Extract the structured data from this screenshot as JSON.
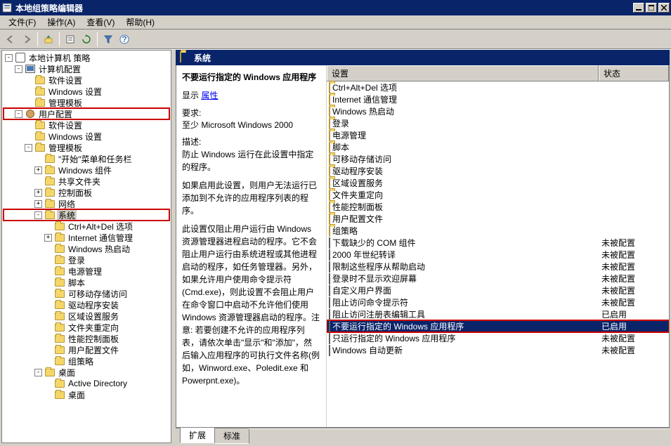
{
  "window": {
    "title": "本地组策略编辑器"
  },
  "menu": {
    "file": "文件(F)",
    "action": "操作(A)",
    "view": "查看(V)",
    "help": "帮助(H)"
  },
  "tree": [
    {
      "depth": 0,
      "exp": "-",
      "icon": "gpo",
      "label": "本地计算机 策略"
    },
    {
      "depth": 1,
      "exp": "-",
      "icon": "computer",
      "label": "计算机配置"
    },
    {
      "depth": 2,
      "exp": " ",
      "icon": "folder",
      "label": "软件设置"
    },
    {
      "depth": 2,
      "exp": " ",
      "icon": "folder",
      "label": "Windows 设置"
    },
    {
      "depth": 2,
      "exp": " ",
      "icon": "folder",
      "label": "管理模板"
    },
    {
      "depth": 1,
      "exp": "-",
      "icon": "user",
      "label": "用户配置",
      "hl": true
    },
    {
      "depth": 2,
      "exp": " ",
      "icon": "folder",
      "label": "软件设置"
    },
    {
      "depth": 2,
      "exp": " ",
      "icon": "folder",
      "label": "Windows 设置"
    },
    {
      "depth": 2,
      "exp": "-",
      "icon": "folder",
      "label": "管理模板"
    },
    {
      "depth": 3,
      "exp": " ",
      "icon": "folder",
      "label": "\"开始\"菜单和任务栏"
    },
    {
      "depth": 3,
      "exp": "+",
      "icon": "folder",
      "label": "Windows 组件"
    },
    {
      "depth": 3,
      "exp": " ",
      "icon": "folder",
      "label": "共享文件夹"
    },
    {
      "depth": 3,
      "exp": "+",
      "icon": "folder",
      "label": "控制面板"
    },
    {
      "depth": 3,
      "exp": "+",
      "icon": "folder",
      "label": "网络"
    },
    {
      "depth": 3,
      "exp": "-",
      "icon": "folder",
      "label": "系统",
      "hl": true,
      "sel": true
    },
    {
      "depth": 4,
      "exp": " ",
      "icon": "folder",
      "label": "Ctrl+Alt+Del 选项"
    },
    {
      "depth": 4,
      "exp": "+",
      "icon": "folder",
      "label": "Internet 通信管理"
    },
    {
      "depth": 4,
      "exp": " ",
      "icon": "folder",
      "label": "Windows 热启动"
    },
    {
      "depth": 4,
      "exp": " ",
      "icon": "folder",
      "label": "登录"
    },
    {
      "depth": 4,
      "exp": " ",
      "icon": "folder",
      "label": "电源管理"
    },
    {
      "depth": 4,
      "exp": " ",
      "icon": "folder",
      "label": "脚本"
    },
    {
      "depth": 4,
      "exp": " ",
      "icon": "folder",
      "label": "可移动存储访问"
    },
    {
      "depth": 4,
      "exp": " ",
      "icon": "folder",
      "label": "驱动程序安装"
    },
    {
      "depth": 4,
      "exp": " ",
      "icon": "folder",
      "label": "区域设置服务"
    },
    {
      "depth": 4,
      "exp": " ",
      "icon": "folder",
      "label": "文件夹重定向"
    },
    {
      "depth": 4,
      "exp": " ",
      "icon": "folder",
      "label": "性能控制面板"
    },
    {
      "depth": 4,
      "exp": " ",
      "icon": "folder",
      "label": "用户配置文件"
    },
    {
      "depth": 4,
      "exp": " ",
      "icon": "folder",
      "label": "组策略"
    },
    {
      "depth": 3,
      "exp": "-",
      "icon": "folder",
      "label": "桌面"
    },
    {
      "depth": 4,
      "exp": " ",
      "icon": "folder",
      "label": "Active Directory"
    },
    {
      "depth": 4,
      "exp": " ",
      "icon": "folder",
      "label": "桌面"
    }
  ],
  "rightHeader": {
    "title": "系统"
  },
  "columns": {
    "name": "设置",
    "state": "状态"
  },
  "desc": {
    "title": "不要运行指定的 Windows 应用程序",
    "show_label": "显示",
    "properties_link": "属性",
    "req_label": "要求:",
    "req_text": "至少 Microsoft Windows 2000",
    "desc_label": "描述:",
    "p1": "防止 Windows 运行在此设置中指定的程序。",
    "p2": "如果启用此设置，则用户无法运行已添加到不允许的应用程序列表的程序。",
    "p3": "此设置仅阻止用户运行由 Windows 资源管理器进程启动的程序。它不会阻止用户运行由系统进程或其他进程启动的程序，如任务管理器。另外，如果允许用户使用命令提示符(Cmd.exe)，则此设置不会阻止用户在命令窗口中启动不允许他们使用 Windows 资源管理器启动的程序。注意: 若要创建不允许的应用程序列表，请依次单击\"显示\"和\"添加\"，然后输入应用程序的可执行文件名称(例如，Winword.exe、Poledit.exe 和 Powerpnt.exe)。"
  },
  "list": [
    {
      "icon": "folder",
      "name": "Ctrl+Alt+Del 选项",
      "state": ""
    },
    {
      "icon": "folder",
      "name": "Internet 通信管理",
      "state": ""
    },
    {
      "icon": "folder",
      "name": "Windows 热启动",
      "state": ""
    },
    {
      "icon": "folder",
      "name": "登录",
      "state": ""
    },
    {
      "icon": "folder",
      "name": "电源管理",
      "state": ""
    },
    {
      "icon": "folder",
      "name": "脚本",
      "state": ""
    },
    {
      "icon": "folder",
      "name": "可移动存储访问",
      "state": ""
    },
    {
      "icon": "folder",
      "name": "驱动程序安装",
      "state": ""
    },
    {
      "icon": "folder",
      "name": "区域设置服务",
      "state": ""
    },
    {
      "icon": "folder",
      "name": "文件夹重定向",
      "state": ""
    },
    {
      "icon": "folder",
      "name": "性能控制面板",
      "state": ""
    },
    {
      "icon": "folder",
      "name": "用户配置文件",
      "state": ""
    },
    {
      "icon": "folder",
      "name": "组策略",
      "state": ""
    },
    {
      "icon": "doc",
      "name": "下载缺少的 COM 组件",
      "state": "未被配置"
    },
    {
      "icon": "doc",
      "name": "2000 年世纪转译",
      "state": "未被配置"
    },
    {
      "icon": "doc",
      "name": "限制这些程序从帮助启动",
      "state": "未被配置"
    },
    {
      "icon": "doc",
      "name": "登录时不显示欢迎屏幕",
      "state": "未被配置"
    },
    {
      "icon": "doc",
      "name": "自定义用户界面",
      "state": "未被配置"
    },
    {
      "icon": "doc",
      "name": "阻止访问命令提示符",
      "state": "未被配置"
    },
    {
      "icon": "doc",
      "name": "阻止访问注册表编辑工具",
      "state": "已启用"
    },
    {
      "icon": "doc",
      "name": "不要运行指定的 Windows 应用程序",
      "state": "已启用",
      "sel": true,
      "hl": true
    },
    {
      "icon": "doc",
      "name": "只运行指定的 Windows 应用程序",
      "state": "未被配置"
    },
    {
      "icon": "doc",
      "name": "Windows 自动更新",
      "state": "未被配置"
    }
  ],
  "tabs": {
    "extended": "扩展",
    "standard": "标准"
  }
}
